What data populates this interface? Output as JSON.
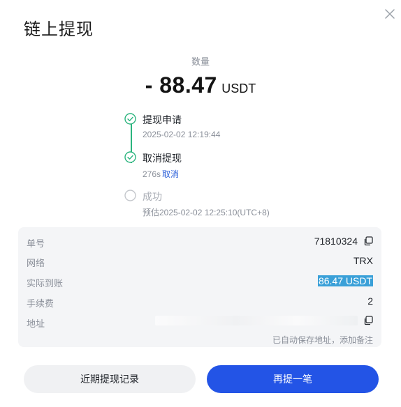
{
  "dialog": {
    "title": "链上提现"
  },
  "amount": {
    "label": "数量",
    "value": "- 88.47",
    "unit": "USDT"
  },
  "timeline": [
    {
      "name": "提现申请",
      "sub": "2025-02-02 12:19:44",
      "status": "done"
    },
    {
      "name": "取消提现",
      "sub": "276s",
      "action": "取消",
      "status": "done"
    },
    {
      "name": "成功",
      "sub": "预估2025-02-02 12:25:10(UTC+8)",
      "status": "pending"
    }
  ],
  "details": {
    "order_label": "单号",
    "order_value": "71810324",
    "network_label": "网络",
    "network_value": "TRX",
    "received_label": "实际到账",
    "received_value": "86.47 USDT",
    "fee_label": "手续费",
    "fee_value": "2",
    "address_label": "地址",
    "address_note": "已自动保存地址，添加备注"
  },
  "buttons": {
    "history": "近期提现记录",
    "again": "再提一笔"
  },
  "colors": {
    "success": "#2bb47e",
    "primary": "#2354e6",
    "link": "#2b5fd9",
    "highlight": "#3aa0d8"
  },
  "icons": {
    "close": "close-icon",
    "check": "check-circle-icon",
    "pending": "empty-circle-icon",
    "copy": "copy-icon"
  }
}
